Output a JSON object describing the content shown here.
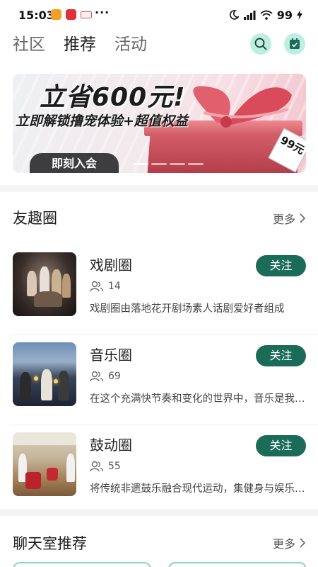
{
  "status_bar": {
    "time": "15:03",
    "more_dots": "···",
    "battery": "99"
  },
  "tabs": [
    {
      "label": "社区",
      "active": false
    },
    {
      "label": "推荐",
      "active": true
    },
    {
      "label": "活动",
      "active": false
    }
  ],
  "header_icons": {
    "search": "search-icon",
    "calendar": "calendar-check-icon"
  },
  "banner": {
    "headline": "立省600元!",
    "subline": "立即解锁撸宠体验+超值权益",
    "cta": "即刻入会",
    "price_tag": "99元"
  },
  "circles_section": {
    "title": "友趣圈",
    "more": "更多",
    "items": [
      {
        "name": "戏剧圈",
        "members": "14",
        "description": "戏剧圈由落地花开剧场素人话剧爱好者组成",
        "follow": "关注"
      },
      {
        "name": "音乐圈",
        "members": "69",
        "description": "在这个充满快节奏和变化的世界中，音乐是我们的陪伴",
        "follow": "关注"
      },
      {
        "name": "鼓动圈",
        "members": "55",
        "description": "将传统非遗鼓乐融合现代运动，集健身与娱乐于一体",
        "follow": "关注"
      }
    ]
  },
  "chatroom_section": {
    "title": "聊天室推荐",
    "more": "更多"
  },
  "colors": {
    "accent": "#1a6b57",
    "accent_light": "#bdeee0"
  }
}
